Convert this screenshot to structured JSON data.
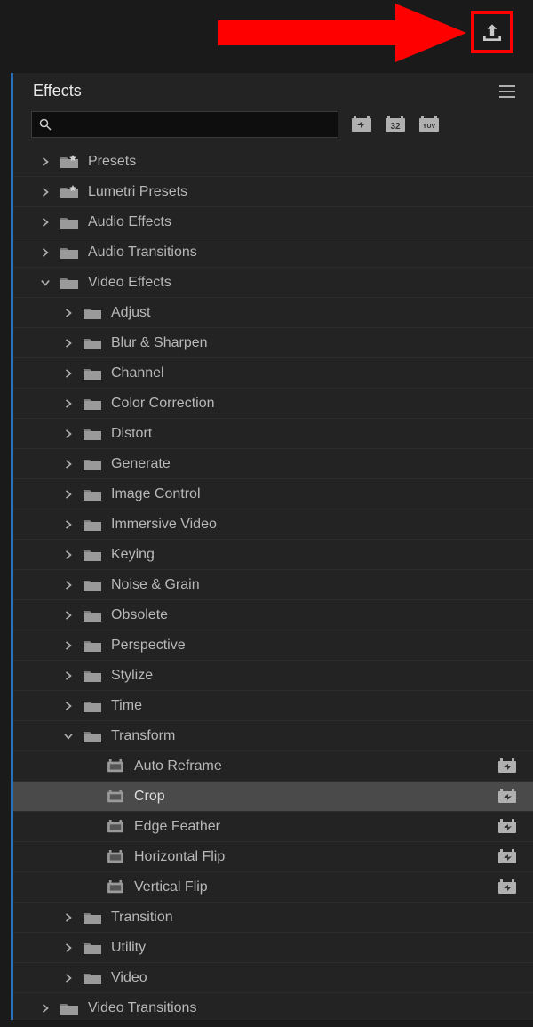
{
  "panel": {
    "title": "Effects"
  },
  "search": {
    "value": "",
    "placeholder": ""
  },
  "tree": [
    {
      "label": "Presets",
      "lvl": 0,
      "exp": "closed",
      "icon": "folder-star"
    },
    {
      "label": "Lumetri Presets",
      "lvl": 0,
      "exp": "closed",
      "icon": "folder-star"
    },
    {
      "label": "Audio Effects",
      "lvl": 0,
      "exp": "closed",
      "icon": "folder"
    },
    {
      "label": "Audio Transitions",
      "lvl": 0,
      "exp": "closed",
      "icon": "folder"
    },
    {
      "label": "Video Effects",
      "lvl": 0,
      "exp": "open",
      "icon": "folder"
    },
    {
      "label": "Adjust",
      "lvl": 1,
      "exp": "closed",
      "icon": "folder"
    },
    {
      "label": "Blur & Sharpen",
      "lvl": 1,
      "exp": "closed",
      "icon": "folder"
    },
    {
      "label": "Channel",
      "lvl": 1,
      "exp": "closed",
      "icon": "folder"
    },
    {
      "label": "Color Correction",
      "lvl": 1,
      "exp": "closed",
      "icon": "folder"
    },
    {
      "label": "Distort",
      "lvl": 1,
      "exp": "closed",
      "icon": "folder"
    },
    {
      "label": "Generate",
      "lvl": 1,
      "exp": "closed",
      "icon": "folder"
    },
    {
      "label": "Image Control",
      "lvl": 1,
      "exp": "closed",
      "icon": "folder"
    },
    {
      "label": "Immersive Video",
      "lvl": 1,
      "exp": "closed",
      "icon": "folder"
    },
    {
      "label": "Keying",
      "lvl": 1,
      "exp": "closed",
      "icon": "folder"
    },
    {
      "label": "Noise & Grain",
      "lvl": 1,
      "exp": "closed",
      "icon": "folder"
    },
    {
      "label": "Obsolete",
      "lvl": 1,
      "exp": "closed",
      "icon": "folder"
    },
    {
      "label": "Perspective",
      "lvl": 1,
      "exp": "closed",
      "icon": "folder"
    },
    {
      "label": "Stylize",
      "lvl": 1,
      "exp": "closed",
      "icon": "folder"
    },
    {
      "label": "Time",
      "lvl": 1,
      "exp": "closed",
      "icon": "folder"
    },
    {
      "label": "Transform",
      "lvl": 1,
      "exp": "open",
      "icon": "folder"
    },
    {
      "label": "Auto Reframe",
      "lvl": 2,
      "exp": "none",
      "icon": "effect",
      "accel": true
    },
    {
      "label": "Crop",
      "lvl": 2,
      "exp": "none",
      "icon": "effect",
      "accel": true,
      "selected": true
    },
    {
      "label": "Edge Feather",
      "lvl": 2,
      "exp": "none",
      "icon": "effect",
      "accel": true
    },
    {
      "label": "Horizontal Flip",
      "lvl": 2,
      "exp": "none",
      "icon": "effect",
      "accel": true
    },
    {
      "label": "Vertical Flip",
      "lvl": 2,
      "exp": "none",
      "icon": "effect",
      "accel": true
    },
    {
      "label": "Transition",
      "lvl": 1,
      "exp": "closed",
      "icon": "folder"
    },
    {
      "label": "Utility",
      "lvl": 1,
      "exp": "closed",
      "icon": "folder"
    },
    {
      "label": "Video",
      "lvl": 1,
      "exp": "closed",
      "icon": "folder"
    },
    {
      "label": "Video Transitions",
      "lvl": 0,
      "exp": "closed",
      "icon": "folder"
    }
  ]
}
